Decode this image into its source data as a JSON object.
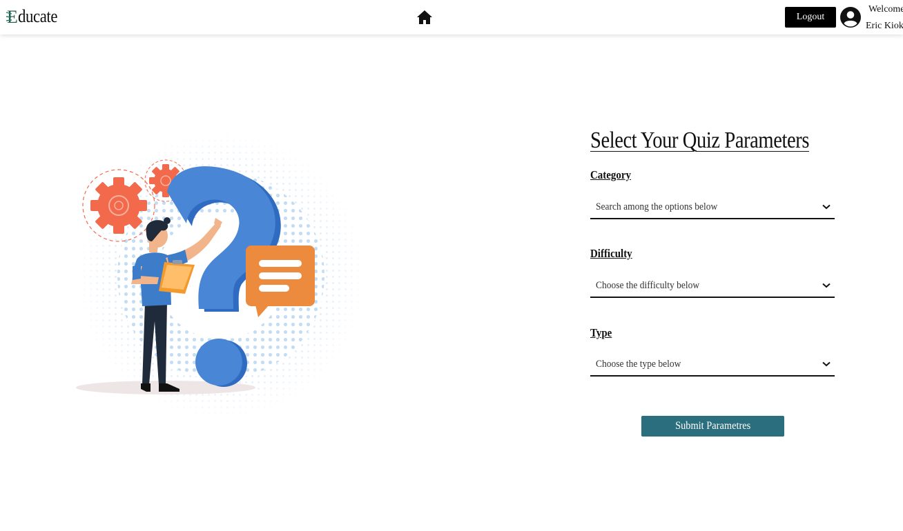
{
  "brand": {
    "logo_letter": "E",
    "logo_rest": "ducate",
    "color": "#1e5a4a"
  },
  "nav": {
    "home_icon": "home-icon",
    "logout_label": "Logout",
    "user_icon": "user-circle-icon",
    "welcome_line1": "Welcome",
    "welcome_line2": "Eric Kioko"
  },
  "form": {
    "title": "Select Your Quiz Parameters",
    "category": {
      "label": "Category",
      "placeholder": "Search among the options below"
    },
    "difficulty": {
      "label": "Difficulty",
      "placeholder": "Choose the difficulty below"
    },
    "type": {
      "label": "Type",
      "placeholder": "Choose the type below"
    },
    "submit_label": "Submit Parametres"
  },
  "colors": {
    "accent": "#2b6e7e",
    "question_mark": "#4a86d6",
    "gear": "#f26a4b",
    "speech_bubble": "#ec8a3e",
    "dots": "#bcdaf4"
  }
}
